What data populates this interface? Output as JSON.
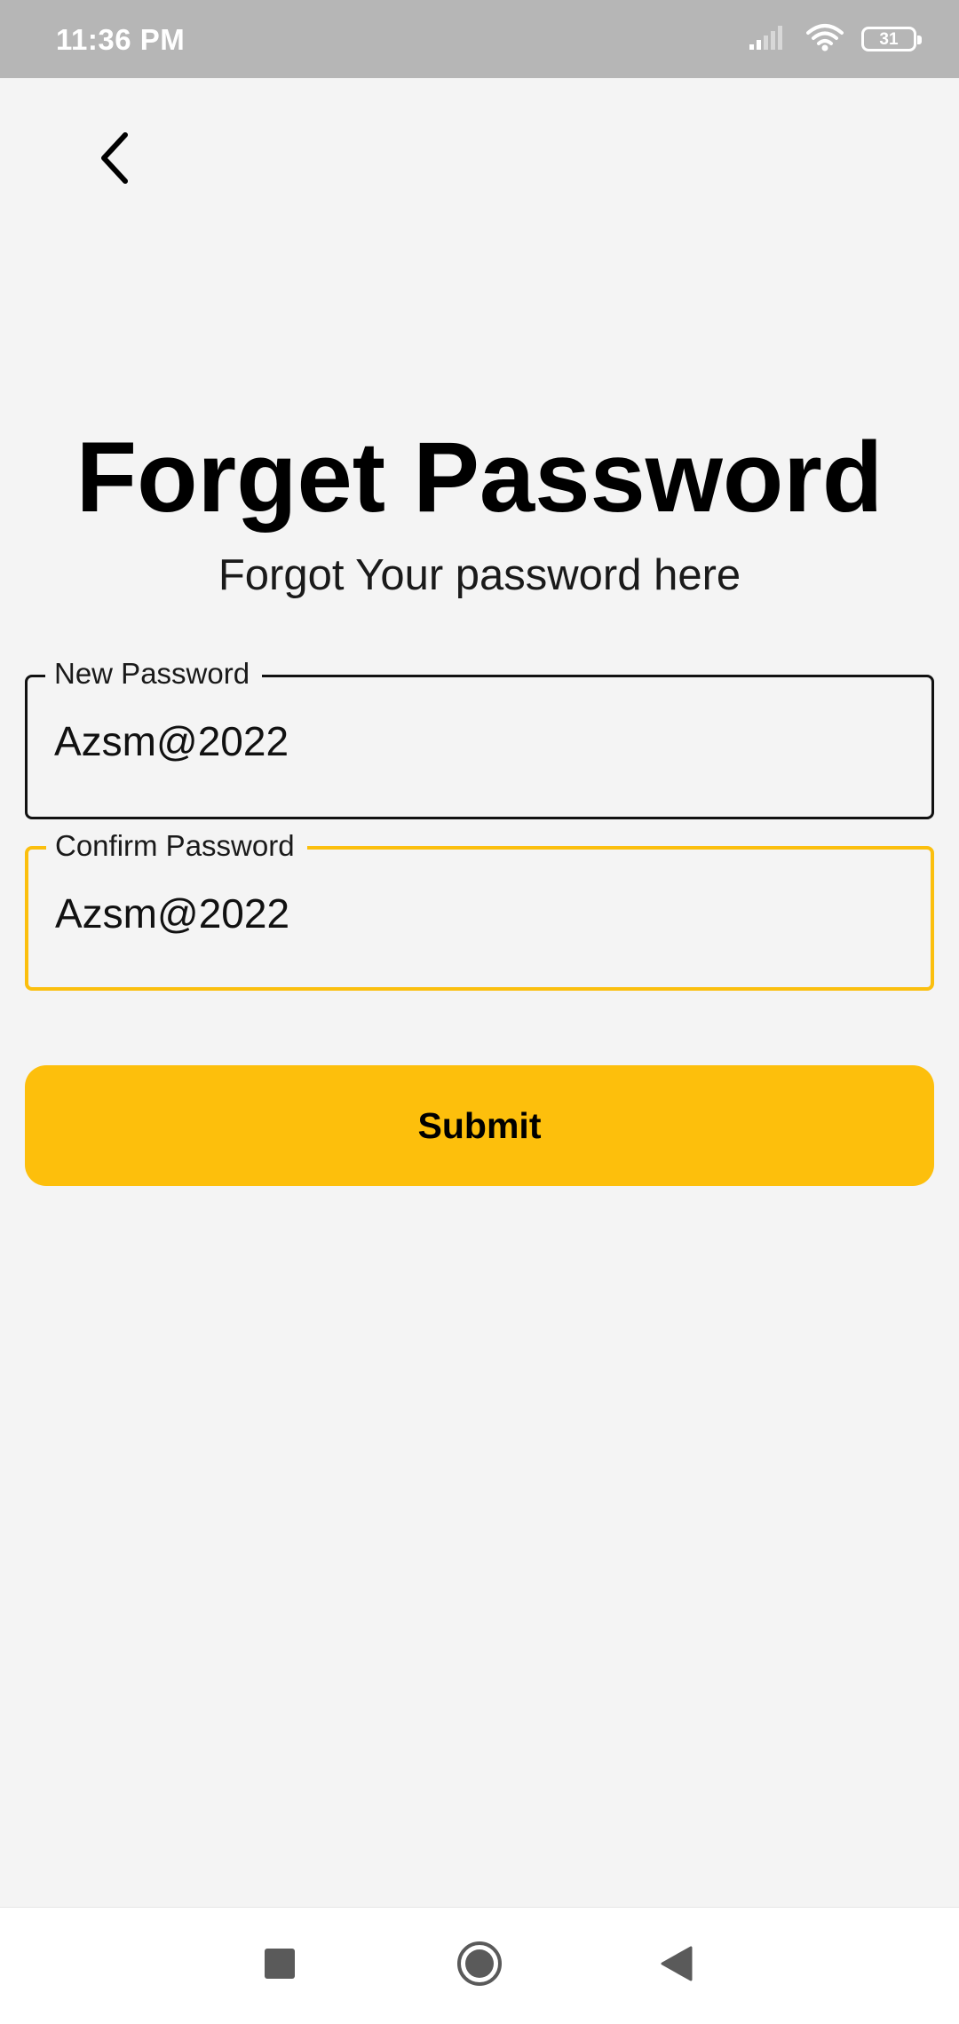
{
  "status_bar": {
    "time": "11:36 PM",
    "battery": "31",
    "icons": [
      "signal-icon",
      "wifi-icon",
      "battery-icon"
    ]
  },
  "header": {
    "back_icon": "chevron-left-icon"
  },
  "main": {
    "title": "Forget Password",
    "subtitle": "Forgot Your password here",
    "new_password": {
      "label": "New Password",
      "value": "Azsm@2022"
    },
    "confirm_password": {
      "label": "Confirm Password",
      "value": "Azsm@2022"
    },
    "submit_label": "Submit"
  },
  "colors": {
    "accent": "#FDBF0C",
    "background": "#F4F4F4",
    "status_bar": "#B6B6B6"
  },
  "nav_bar": {
    "icons": [
      "recents-square-icon",
      "home-circle-icon",
      "back-triangle-icon"
    ]
  }
}
